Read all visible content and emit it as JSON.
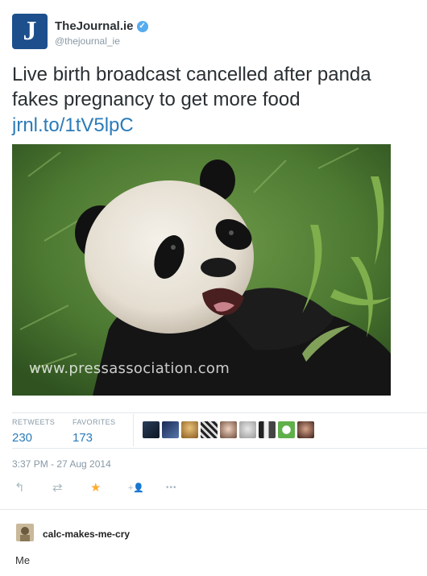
{
  "tweet": {
    "author_name": "TheJournal.ie",
    "author_handle": "@thejournal_ie",
    "avatar_letter": "J",
    "text": "Live birth broadcast cancelled after panda fakes pregnancy to get more food",
    "link": "jrnl.to/1tV5lpC",
    "photo_watermark": "www.pressassociation.com",
    "stats": {
      "retweets_label": "RETWEETS",
      "retweets_count": "230",
      "favorites_label": "FAVORITES",
      "favorites_count": "173"
    },
    "timestamp": "3:37 PM - 27 Aug 2014",
    "actions": {
      "reply_icon": "↰",
      "retweet_icon": "⇄",
      "favorite_icon": "★",
      "follow_icon": "+👤",
      "more_icon": "•••"
    }
  },
  "reply": {
    "username": "calc-makes-me-cry",
    "text": "Me"
  },
  "colors": {
    "brand_blue": "#2b7bb9",
    "verified": "#55acee",
    "favorite": "#ffac33",
    "muted": "#8899a6"
  }
}
